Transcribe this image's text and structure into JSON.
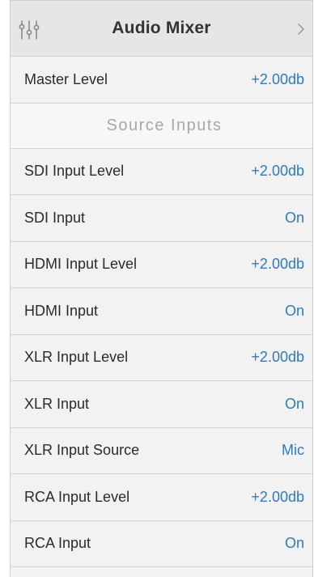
{
  "header": {
    "title": "Audio Mixer",
    "icon": "mixer-sliders-icon",
    "chevron_icon": "chevron-right-icon"
  },
  "rows": [
    {
      "label": "Master Level",
      "value": "+2.00db"
    }
  ],
  "section": {
    "title": "Source Inputs"
  },
  "source_rows": [
    {
      "label": "SDI Input Level",
      "value": "+2.00db"
    },
    {
      "label": "SDI Input",
      "value": "On"
    },
    {
      "label": "HDMI Input Level",
      "value": "+2.00db"
    },
    {
      "label": "HDMI Input",
      "value": "On"
    },
    {
      "label": "XLR Input Level",
      "value": "+2.00db"
    },
    {
      "label": "XLR Input",
      "value": "On"
    },
    {
      "label": "XLR Input Source",
      "value": "Mic"
    },
    {
      "label": "RCA Input Level",
      "value": "+2.00db"
    },
    {
      "label": "RCA Input",
      "value": "On"
    }
  ],
  "colors": {
    "value_accent": "#2d79c7",
    "header_bg": "#e6e6e6",
    "row_bg": "#f2f2f2"
  }
}
